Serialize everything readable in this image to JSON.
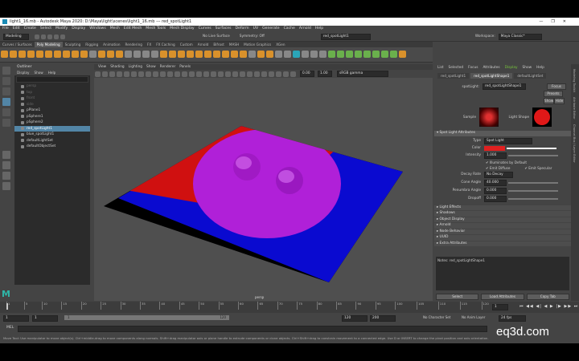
{
  "window": {
    "title": "light1_16.mb - Autodesk Maya 2020: D:\\Maya\\light\\scenes\\light1_16.mb  ---  red_spotLight1",
    "controls": [
      "—",
      "❐",
      "✕"
    ]
  },
  "menubar": [
    "File",
    "Edit",
    "Create",
    "Select",
    "Modify",
    "Display",
    "Windows",
    "Mesh",
    "Edit Mesh",
    "Mesh Tools",
    "Mesh Display",
    "Curves",
    "Surfaces",
    "Deform",
    "UV",
    "Generate",
    "Cache",
    "Arnold",
    "Help"
  ],
  "statusline": {
    "mode": "Modeling",
    "no_live_surface": "No Live Surface",
    "symmetry": "Symmetry: Off",
    "object_field": "red_spotLight1",
    "workspace_label": "Workspace:",
    "workspace_value": "Maya Classic*"
  },
  "shelf": {
    "tabs": [
      "Curves / Surfaces",
      "Poly Modeling",
      "Sculpting",
      "Rigging",
      "Animation",
      "Rendering",
      "FX",
      "FX Caching",
      "Custom",
      "Arnold",
      "Bifrost",
      "MASH",
      "Motion Graphics",
      "XGen"
    ],
    "active_tab": "Poly Modeling"
  },
  "outliner": {
    "title": "Outliner",
    "menu": [
      "Display",
      "Show",
      "Help"
    ],
    "items": [
      {
        "label": "persp",
        "state": "dim"
      },
      {
        "label": "top",
        "state": "dim"
      },
      {
        "label": "front",
        "state": "dim"
      },
      {
        "label": "side",
        "state": "dim"
      },
      {
        "label": "pPlane1",
        "state": "normal"
      },
      {
        "label": "pSphere1",
        "state": "normal"
      },
      {
        "label": "pSphere2",
        "state": "normal"
      },
      {
        "label": "red_spotLight1",
        "state": "selected"
      },
      {
        "label": "blue_spotLight1",
        "state": "normal"
      },
      {
        "label": "defaultLightSet",
        "state": "normal"
      },
      {
        "label": "defaultObjectSet",
        "state": "normal"
      }
    ]
  },
  "viewport": {
    "menu": [
      "View",
      "Shading",
      "Lighting",
      "Show",
      "Renderer",
      "Panels"
    ],
    "field1": "0.00",
    "field2": "1.00",
    "colorspace": "sRGB gamma",
    "camera": "persp"
  },
  "attribute_editor": {
    "tabs": [
      "List",
      "Selected",
      "Focus",
      "Attributes",
      "Display",
      "Show",
      "Help"
    ],
    "highlight_tab": "Display",
    "node_tabs": [
      "red_spotLight1",
      "red_spotLightShape1",
      "defaultLightSet"
    ],
    "active_node_tab": "red_spotLightShape1",
    "node_label": "spotLight:",
    "node_name": "red_spotLightShape1",
    "focus_button": "Focus",
    "presets_button": "Presets",
    "show_button": "Show",
    "hide_button": "Hide",
    "sample_label": "Sample",
    "light_shape_label": "Light Shape",
    "section_open": "Spot Light Attributes",
    "type_label": "Type",
    "type_value": "Spot Light",
    "color_label": "Color",
    "light_color": "#e02020",
    "intensity_label": "Intensity",
    "intensity_value": "1.000",
    "illum_default": "Illuminates by Default",
    "emit_diffuse": "Emit Diffuse",
    "emit_specular": "Emit Specular",
    "decay_label": "Decay Rate",
    "decay_value": "No Decay",
    "cone_label": "Cone Angle",
    "cone_value": "40.000",
    "penumbra_label": "Penumbra Angle",
    "penumbra_value": "0.000",
    "dropoff_label": "Dropoff",
    "dropoff_value": "0.000",
    "closed_sections": [
      "Light Effects",
      "Shadows",
      "Object Display",
      "Arnold",
      "Node Behavior",
      "UUID",
      "Extra Attributes"
    ],
    "notes_label": "Notes: red_spotLightShape1",
    "select_button": "Select",
    "load_attr_button": "Load Attributes",
    "copy_tab_button": "Copy Tab"
  },
  "sidebar_tabs": [
    "Modeling Toolkit",
    "Attribute Editor",
    "Channel Box / Layer Editor"
  ],
  "timeline": {
    "ticks": [
      "1",
      "5",
      "10",
      "15",
      "20",
      "25",
      "30",
      "35",
      "40",
      "45",
      "50",
      "55",
      "60",
      "65",
      "70",
      "75",
      "80",
      "85",
      "90",
      "95",
      "100",
      "105",
      "110",
      "115",
      "120"
    ],
    "current_frame": "1",
    "range_start": "1",
    "range_start2": "1",
    "range_marker": "1",
    "range_end_inner": "120",
    "range_end": "120",
    "range_end2": "200",
    "character_set": "No Character Set",
    "anim_layer": "No Anim Layer",
    "fps": "24 fps"
  },
  "mel": {
    "label": "MEL",
    "help": "Move Tool: Use manipulator to move object(s). Ctrl+middle-drag to move components along normals. Shift+drag manipulator axis or plane handle to extrude components or clone objects. Ctrl+Shift+drag to constrain movement to a connected edge. Use D or INSERT to change the pivot position and axis orientation."
  },
  "watermark": "eq3d.com"
}
